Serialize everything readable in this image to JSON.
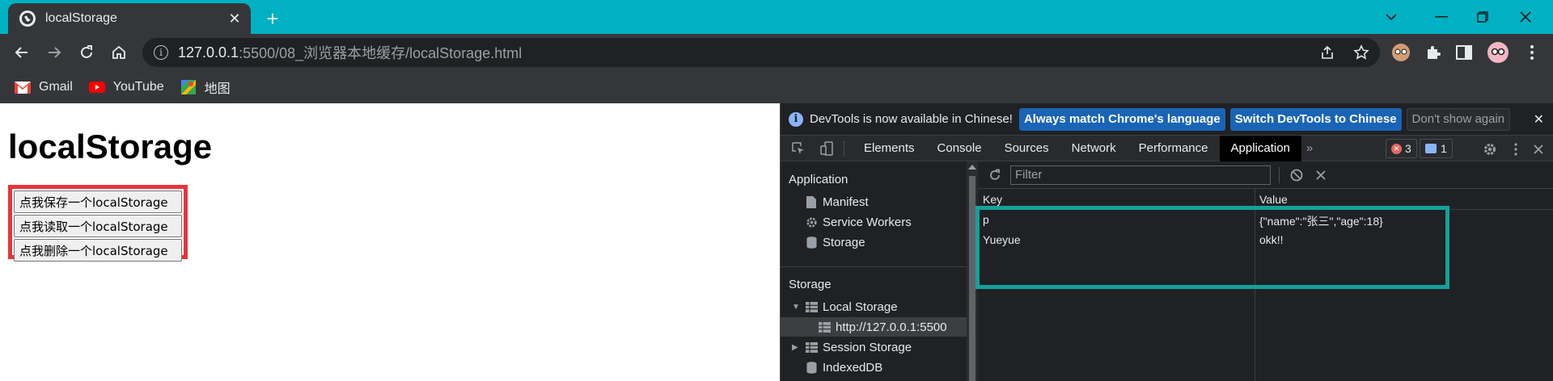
{
  "browser": {
    "tab": {
      "title": "localStorage"
    },
    "address": {
      "host": "127.0.0.1",
      "rest": ":5500/08_浏览器本地缓存/localStorage.html"
    },
    "bookmarks": [
      {
        "label": "Gmail",
        "icon": "gmail-icon"
      },
      {
        "label": "YouTube",
        "icon": "youtube-icon"
      },
      {
        "label": "地图",
        "icon": "maps-icon"
      }
    ],
    "colors": {
      "titlebar": "#00b1c3",
      "toolbar": "#35363a"
    }
  },
  "page": {
    "heading": "localStorage",
    "buttons": [
      {
        "label": "点我保存一个localStorage"
      },
      {
        "label": "点我读取一个localStorage"
      },
      {
        "label": "点我删除一个localStorage"
      }
    ],
    "colors": {
      "button_box_border": "#e8343c"
    }
  },
  "devtools": {
    "infobar": {
      "message": "DevTools is now available in Chinese!",
      "btn_match": "Always match Chrome's language",
      "btn_switch": "Switch DevTools to Chinese",
      "btn_dismiss": "Don't show again"
    },
    "tabs": [
      {
        "label": "Elements"
      },
      {
        "label": "Console"
      },
      {
        "label": "Sources"
      },
      {
        "label": "Network"
      },
      {
        "label": "Performance"
      },
      {
        "label": "Application"
      }
    ],
    "active_tab": "Application",
    "more_tabs": "»",
    "error_count": "3",
    "message_count": "1",
    "sidebar": {
      "application_header": "Application",
      "application_items": [
        "Manifest",
        "Service Workers",
        "Storage"
      ],
      "storage_header": "Storage",
      "local_storage": "Local Storage",
      "local_storage_origin": "http://127.0.0.1:5500",
      "session_storage": "Session Storage",
      "indexeddb": "IndexedDB"
    },
    "storage": {
      "filter_placeholder": "Filter",
      "columns": {
        "key": "Key",
        "value": "Value"
      },
      "rows": [
        {
          "key": "p",
          "value": "{\"name\":\"张三\",\"age\":18}"
        },
        {
          "key": "Yueyue",
          "value": "okk!!"
        }
      ]
    },
    "colors": {
      "highlight_border": "#12a29a",
      "primary_button": "#1a64b5"
    }
  }
}
